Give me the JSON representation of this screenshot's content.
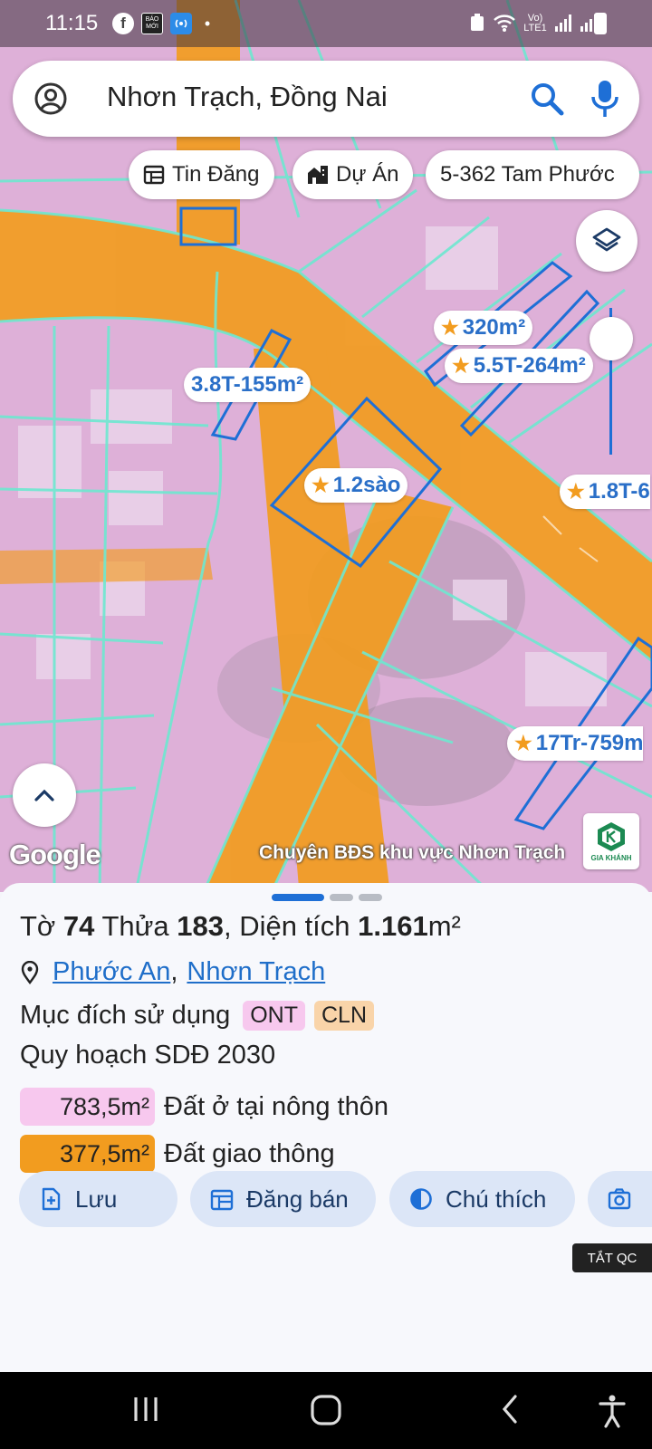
{
  "status_bar": {
    "time": "11:15",
    "baomoi": "BÁO MỚI",
    "dot": "•",
    "network": "Vo) LTE1"
  },
  "search": {
    "query": "Nhơn Trạch, Đồng Nai"
  },
  "chips": [
    {
      "label": "Tin Đăng",
      "icon": "listing-icon"
    },
    {
      "label": "Dự Án",
      "icon": "building-icon"
    },
    {
      "label": "5-362 Tam Phước",
      "icon": ""
    }
  ],
  "map_labels": [
    {
      "text": "320m²",
      "star": true
    },
    {
      "text": "5.5T-264m²",
      "star": true
    },
    {
      "text": "3.8T-155m²",
      "star": false
    },
    {
      "text": "1.2sào",
      "star": true
    },
    {
      "text": "1.8T-6",
      "star": true
    },
    {
      "text": "17Tr-759m",
      "star": true
    }
  ],
  "map_footer": {
    "google": "Google",
    "credit": "Chuyên BĐS khu vực Nhơn Trạch",
    "logo_text": "GIA KHÁNH"
  },
  "parcel": {
    "to_label": "Tờ",
    "to_value": "74",
    "thua_label": "Thửa",
    "thua_value": "183",
    "area_label": ", Diện tích",
    "area_value": "1.161",
    "area_unit": "m²",
    "ward": "Phước An",
    "separator": ",",
    "district": "Nhơn Trạch",
    "purpose_label": "Mục đích sử dụng",
    "purpose_tags": [
      "ONT",
      "CLN"
    ],
    "plan_label": "Quy hoạch SDĐ 2030",
    "areas": [
      {
        "value": "783,5m²",
        "label": "Đất ở tại nông thôn",
        "color": "#f7c8ee"
      },
      {
        "value": "377,5m²",
        "label": "Đất giao thông",
        "color": "#f29c1f"
      }
    ]
  },
  "actions": [
    {
      "label": "Lưu",
      "icon": "add-doc-icon"
    },
    {
      "label": "Đăng bán",
      "icon": "calendar-icon"
    },
    {
      "label": "Chú thích",
      "icon": "contrast-icon"
    },
    {
      "label": "",
      "icon": "camera-icon"
    }
  ],
  "ads_off": "TẮT QC",
  "colors": {
    "accent": "#1e6fd6",
    "land_residential": "#f7c8ee",
    "land_road": "#f29c1f",
    "parcel_line": "#6ee8d0"
  }
}
